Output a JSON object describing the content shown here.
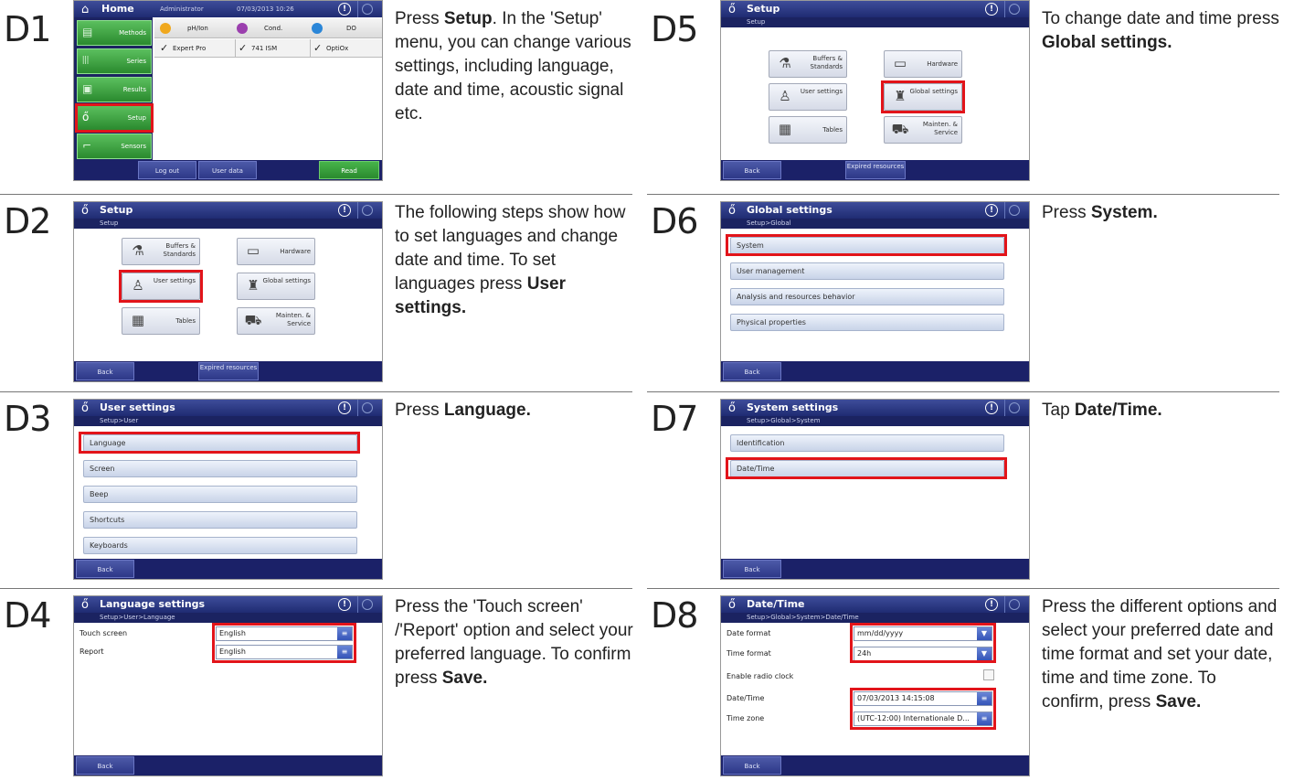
{
  "icons": {
    "home": "home-icon",
    "setup": "setup-icon",
    "info": "info-icon",
    "refresh": "refresh-icon",
    "buffers": "buffers-icon",
    "hardware": "hardware-icon",
    "user": "user-icon",
    "global": "global-icon",
    "tables": "tables-icon",
    "mainten": "mainten-icon",
    "dropdown": "chevron-down-icon",
    "list": "list-icon",
    "check": "check-icon"
  },
  "colors": {
    "title_bar": "#2a3683",
    "sub_bar": "#1b2361",
    "highlight": "#e2141a",
    "read_button": "#39a33c"
  },
  "d1": {
    "label": "D1",
    "desc_pre": "Press ",
    "desc_bold": "Setup",
    "desc_post": ". In the 'Setup' menu, you can change various settings, including language, date and time, acoustic signal etc.",
    "title": "Home",
    "user": "Administrator",
    "datetime": "07/03/2013 10:26",
    "nav": [
      "Methods",
      "Series",
      "Results",
      "Setup",
      "Sensors"
    ],
    "channels": [
      {
        "name": "pH/Ion",
        "color": "#f0a81e",
        "sensor": "Expert Pro"
      },
      {
        "name": "Cond.",
        "color": "#9b3fae",
        "sensor": "741 ISM"
      },
      {
        "name": "DO",
        "color": "#2a86d8",
        "sensor": "OptiOx"
      }
    ],
    "bottom": [
      "Log out",
      "User data",
      "Read"
    ]
  },
  "d2": {
    "label": "D2",
    "desc_pre": "The following steps show how to set languages and change date and time. To set languages press ",
    "desc_bold": "User settings.",
    "desc_post": "",
    "title": "Setup",
    "path": "Setup",
    "tiles": [
      "Buffers & Standards",
      "Hardware",
      "User settings",
      "Global settings",
      "Tables",
      "Mainten. & Service"
    ],
    "back": "Back",
    "expired": "Expired resources"
  },
  "d3": {
    "label": "D3",
    "desc_pre": "Press ",
    "desc_bold": "Language.",
    "desc_post": "",
    "title": "User settings",
    "path": "Setup>User",
    "items": [
      "Language",
      "Screen",
      "Beep",
      "Shortcuts",
      "Keyboards"
    ],
    "back": "Back"
  },
  "d4": {
    "label": "D4",
    "desc_pre": "Press the 'Touch screen' /'Report' option and select your preferred language. To confirm press ",
    "desc_bold": "Save.",
    "desc_post": "",
    "title": "Language settings",
    "path": "Setup>User>Language",
    "rows": [
      {
        "name": "Touch screen",
        "value": "English"
      },
      {
        "name": "Report",
        "value": "English"
      }
    ],
    "back": "Back"
  },
  "d5": {
    "label": "D5",
    "desc_pre": "To change date and time press ",
    "desc_bold": "Global settings.",
    "desc_post": "",
    "title": "Setup",
    "path": "Setup",
    "back": "Back",
    "expired": "Expired resources"
  },
  "d6": {
    "label": "D6",
    "desc_pre": "Press ",
    "desc_bold": "System.",
    "desc_post": "",
    "title": "Global settings",
    "path": "Setup>Global",
    "items": [
      "System",
      "User management",
      "Analysis and resources behavior",
      "Physical properties"
    ],
    "back": "Back"
  },
  "d7": {
    "label": "D7",
    "desc_pre": "Tap ",
    "desc_bold": "Date/Time.",
    "desc_post": "",
    "title": "System settings",
    "path": "Setup>Global>System",
    "items": [
      "Identification",
      "Date/Time"
    ],
    "back": "Back"
  },
  "d8": {
    "label": "D8",
    "desc_pre": "Press the different options and select your preferred date and time format and set your date, time and time zone. To confirm, press ",
    "desc_bold": "Save.",
    "desc_post": "",
    "title": "Date/Time",
    "path": "Setup>Global>System>Date/Time",
    "rows": [
      {
        "name": "Date format",
        "value": "mm/dd/yyyy"
      },
      {
        "name": "Time format",
        "value": "24h"
      },
      {
        "name": "Enable radio clock",
        "value": ""
      },
      {
        "name": "Date/Time",
        "value": "07/03/2013 14:15:08"
      },
      {
        "name": "Time zone",
        "value": "(UTC-12:00) Internationale D..."
      }
    ],
    "back": "Back"
  }
}
